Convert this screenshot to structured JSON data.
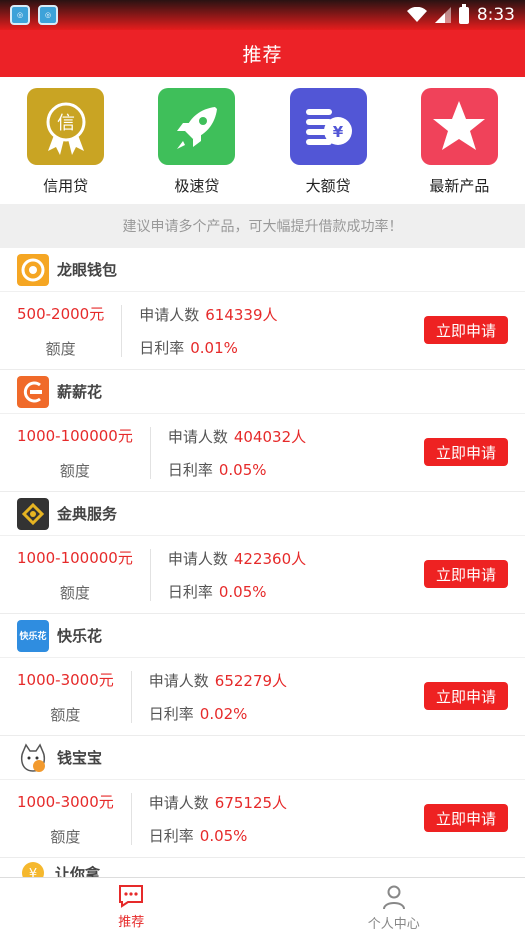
{
  "status_bar": {
    "time": "8:33"
  },
  "header": {
    "title": "推荐"
  },
  "categories": [
    {
      "label": "信用贷",
      "icon": "credit-badge-icon",
      "color": "#c9a423",
      "glyph": "信"
    },
    {
      "label": "极速贷",
      "icon": "rocket-icon",
      "color": "#3fbf5a"
    },
    {
      "label": "大额贷",
      "icon": "coins-yen-icon",
      "color": "#5256d6",
      "glyph": "¥"
    },
    {
      "label": "最新产品",
      "icon": "star-icon",
      "color": "#f0425a"
    }
  ],
  "tip": "建议申请多个产品，可大幅提升借款成功率！",
  "labels": {
    "amount": "额度",
    "applicants": "申请人数",
    "daily_rate": "日利率",
    "apply": "立即申请"
  },
  "products": [
    {
      "name": "龙眼钱包",
      "amount": "500-2000元",
      "applicants": "614339人",
      "rate": "0.01%",
      "logo_color": "#f5a623"
    },
    {
      "name": "薪薪花",
      "amount": "1000-100000元",
      "applicants": "404032人",
      "rate": "0.05%",
      "logo_color": "#f06a2a"
    },
    {
      "name": "金典服务",
      "amount": "1000-100000元",
      "applicants": "422360人",
      "rate": "0.05%",
      "logo_color": "#333333"
    },
    {
      "name": "快乐花",
      "amount": "1000-3000元",
      "applicants": "652279人",
      "rate": "0.02%",
      "logo_color": "#2f8de0",
      "logo_text": "快乐花"
    },
    {
      "name": "钱宝宝",
      "amount": "1000-3000元",
      "applicants": "675125人",
      "rate": "0.05%",
      "logo_color": "#ffffff"
    }
  ],
  "partial_product": {
    "name": "让你拿"
  },
  "bottom_nav": [
    {
      "label": "推荐",
      "active": true
    },
    {
      "label": "个人中心",
      "active": false
    }
  ]
}
